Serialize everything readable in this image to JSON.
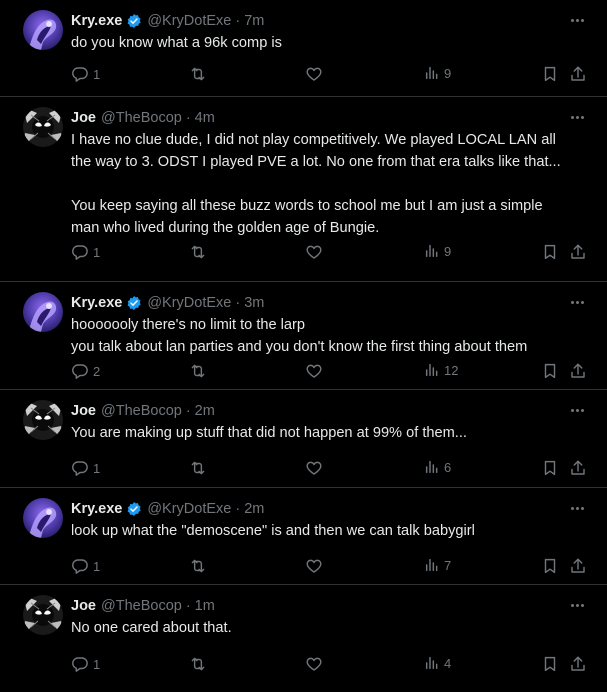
{
  "tweets": [
    {
      "name": "Kry.exe",
      "verified": true,
      "handle": "@KryDotExe",
      "time": "7m",
      "avatar": "kry",
      "lines": [
        "do you know what a 96k comp is"
      ],
      "replies": "1",
      "retweets": "",
      "likes": "",
      "views": "9"
    },
    {
      "name": "Joe",
      "verified": false,
      "handle": "@TheBocop",
      "time": "4m",
      "avatar": "joe",
      "lines": [
        "I have no clue dude, I did not play competitively.  We played LOCAL LAN all",
        "the way to 3.  ODST I played PVE a lot.  No one from that era talks like that...",
        "You keep saying all these buzz words to school me but I am just a simple",
        "man who lived during the golden age of Bungie."
      ],
      "replies": "1",
      "retweets": "",
      "likes": "",
      "views": "9"
    },
    {
      "name": "Kry.exe",
      "verified": true,
      "handle": "@KryDotExe",
      "time": "3m",
      "avatar": "kry",
      "lines": [
        "hooooooly there's no limit to the larp",
        "you talk about lan parties and you don't know the first thing about them"
      ],
      "replies": "2",
      "retweets": "",
      "likes": "",
      "views": "12"
    },
    {
      "name": "Joe",
      "verified": false,
      "handle": "@TheBocop",
      "time": "2m",
      "avatar": "joe",
      "lines": [
        "You are making up stuff that did not happen at 99% of them..."
      ],
      "replies": "1",
      "retweets": "",
      "likes": "",
      "views": "6"
    },
    {
      "name": "Kry.exe",
      "verified": true,
      "handle": "@KryDotExe",
      "time": "2m",
      "avatar": "kry",
      "lines": [
        "look up what the \"demoscene\" is and then we can talk babygirl"
      ],
      "replies": "1",
      "retweets": "",
      "likes": "",
      "views": "7"
    },
    {
      "name": "Joe",
      "verified": false,
      "handle": "@TheBocop",
      "time": "1m",
      "avatar": "joe",
      "lines": [
        "No one cared about that."
      ],
      "replies": "1",
      "retweets": "",
      "likes": "",
      "views": "4"
    }
  ],
  "colors": {
    "background": "#000000",
    "text": "#e7e9ea",
    "muted": "#71767b",
    "verified": "#1d9bf0",
    "divider": "#2f3336"
  },
  "icons": [
    "reply-icon",
    "retweet-icon",
    "like-icon",
    "views-icon",
    "bookmark-icon",
    "share-icon",
    "more-icon",
    "verified-badge-icon"
  ]
}
